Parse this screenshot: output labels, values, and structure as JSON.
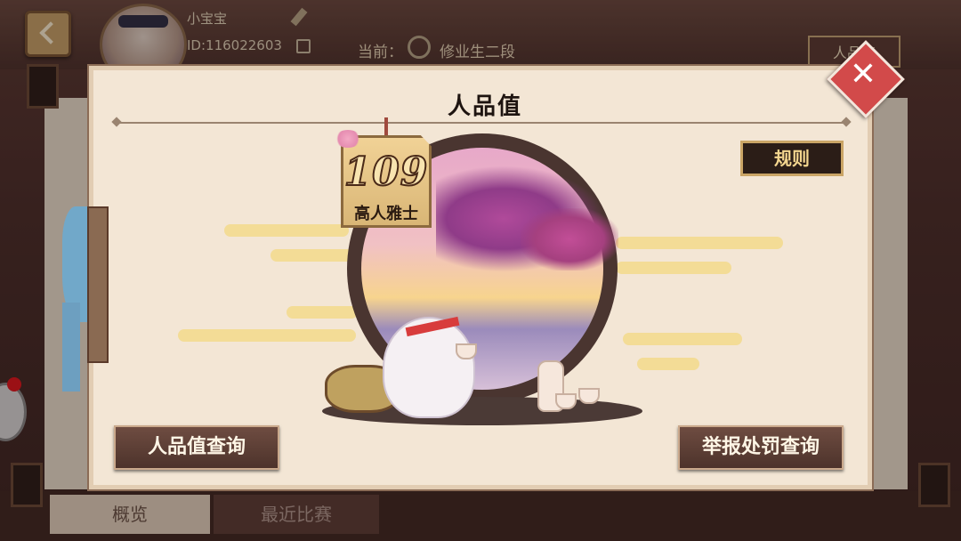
{
  "header": {
    "username": "小宝宝",
    "user_id": "ID:116022603",
    "rank_label": "当前：",
    "rank_value": "修业生二段",
    "right_tab": "人品值"
  },
  "bottom_tabs": [
    {
      "label": "概览",
      "active": true
    },
    {
      "label": "最近比赛",
      "active": false
    }
  ],
  "modal": {
    "title": "人品值",
    "rules_button": "规则",
    "score": "109",
    "score_title": "高人雅士",
    "left_button": "人品值查询",
    "right_button": "举报处罚查询",
    "close_icon": "close-icon"
  },
  "colors": {
    "modal_bg": "#f3e6d5",
    "button_dark": "#4d332b",
    "rules_text": "#f4d68f",
    "close_red": "#d24a4a"
  }
}
